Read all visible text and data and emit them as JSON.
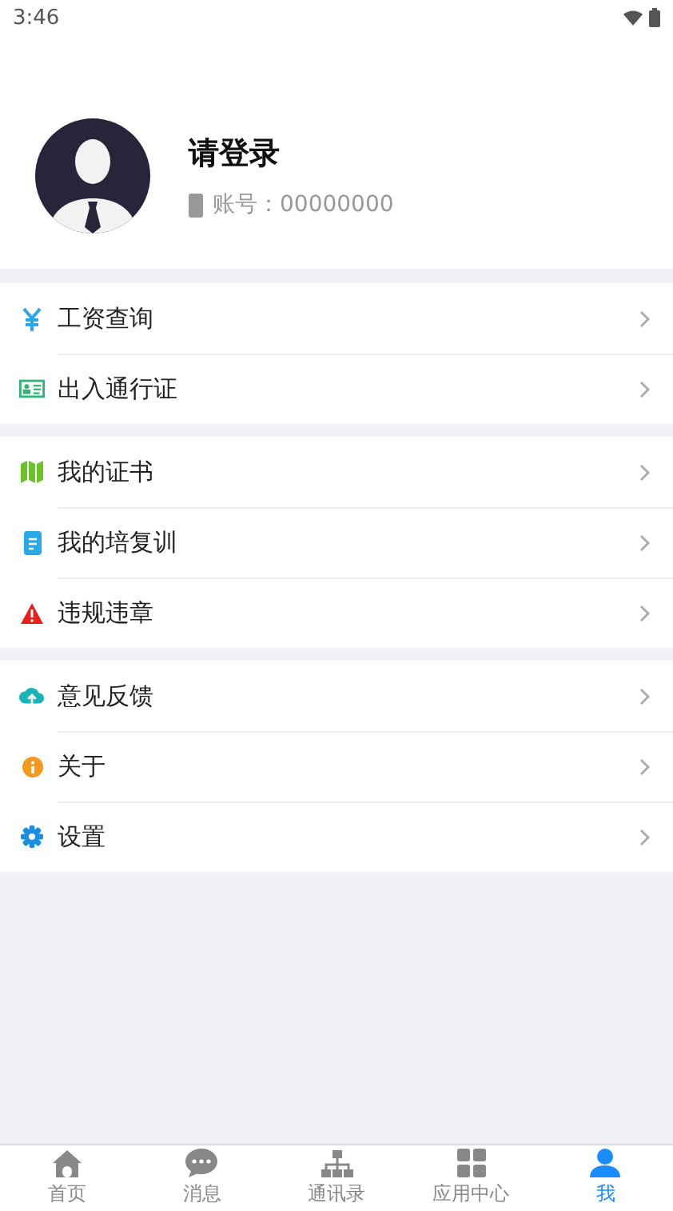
{
  "status_bar": {
    "time": "3:46"
  },
  "profile": {
    "name": "请登录",
    "account": "账号：00000000"
  },
  "menu_groups": [
    {
      "items": [
        {
          "kind": "yen",
          "label": "工资查询"
        },
        {
          "kind": "idcard",
          "label": "出入通行证"
        }
      ]
    },
    {
      "items": [
        {
          "kind": "map",
          "label": "我的证书"
        },
        {
          "kind": "doc",
          "label": "我的培复训"
        },
        {
          "kind": "warning",
          "label": "违规违章"
        }
      ]
    },
    {
      "items": [
        {
          "kind": "cloud",
          "label": "意见反馈"
        },
        {
          "kind": "info",
          "label": "关于"
        },
        {
          "kind": "gear",
          "label": "设置"
        }
      ]
    }
  ],
  "tab_bar": [
    {
      "kind": "home",
      "label": "首页",
      "selected": false
    },
    {
      "kind": "chat",
      "label": "消息",
      "selected": false
    },
    {
      "kind": "org",
      "label": "通讯录",
      "selected": false
    },
    {
      "kind": "grid",
      "label": "应用中心",
      "selected": false
    },
    {
      "kind": "person",
      "label": "我",
      "selected": true
    }
  ]
}
